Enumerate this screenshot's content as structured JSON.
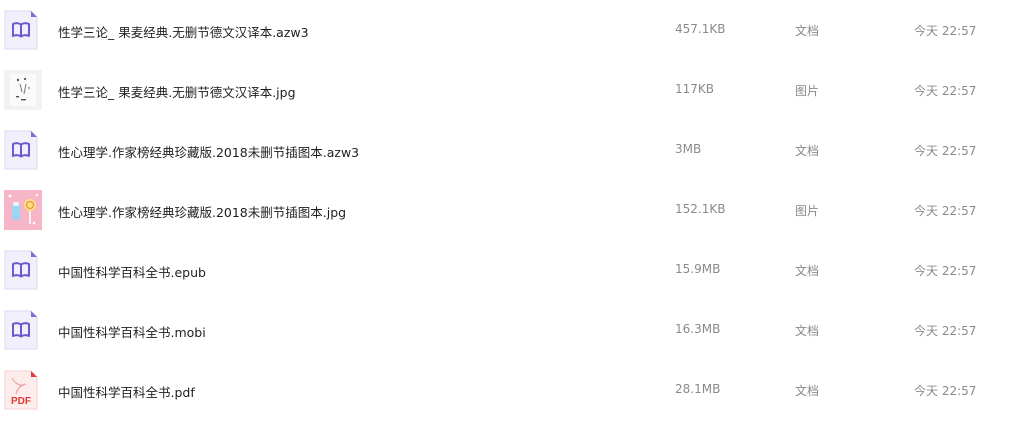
{
  "files": [
    {
      "name": "性学三论_ 果麦经典.无删节德文汉译本.azw3",
      "size": "457.1KB",
      "type": "文档",
      "time": "今天 22:57",
      "icon": "ebook-icon"
    },
    {
      "name": "性学三论_ 果麦经典.无删节德文汉译本.jpg",
      "size": "117KB",
      "type": "图片",
      "time": "今天 22:57",
      "icon": "image-thumbnail"
    },
    {
      "name": "性心理学.作家榜经典珍藏版.2018未删节插图本.azw3",
      "size": "3MB",
      "type": "文档",
      "time": "今天 22:57",
      "icon": "ebook-icon"
    },
    {
      "name": "性心理学.作家榜经典珍藏版.2018未删节插图本.jpg",
      "size": "152.1KB",
      "type": "图片",
      "time": "今天 22:57",
      "icon": "image-thumbnail"
    },
    {
      "name": "中国性科学百科全书.epub",
      "size": "15.9MB",
      "type": "文档",
      "time": "今天 22:57",
      "icon": "ebook-icon"
    },
    {
      "name": "中国性科学百科全书.mobi",
      "size": "16.3MB",
      "type": "文档",
      "time": "今天 22:57",
      "icon": "ebook-icon"
    },
    {
      "name": "中国性科学百科全书.pdf",
      "size": "28.1MB",
      "type": "文档",
      "time": "今天 22:57",
      "icon": "pdf-icon",
      "icon_text": "PDF"
    }
  ]
}
